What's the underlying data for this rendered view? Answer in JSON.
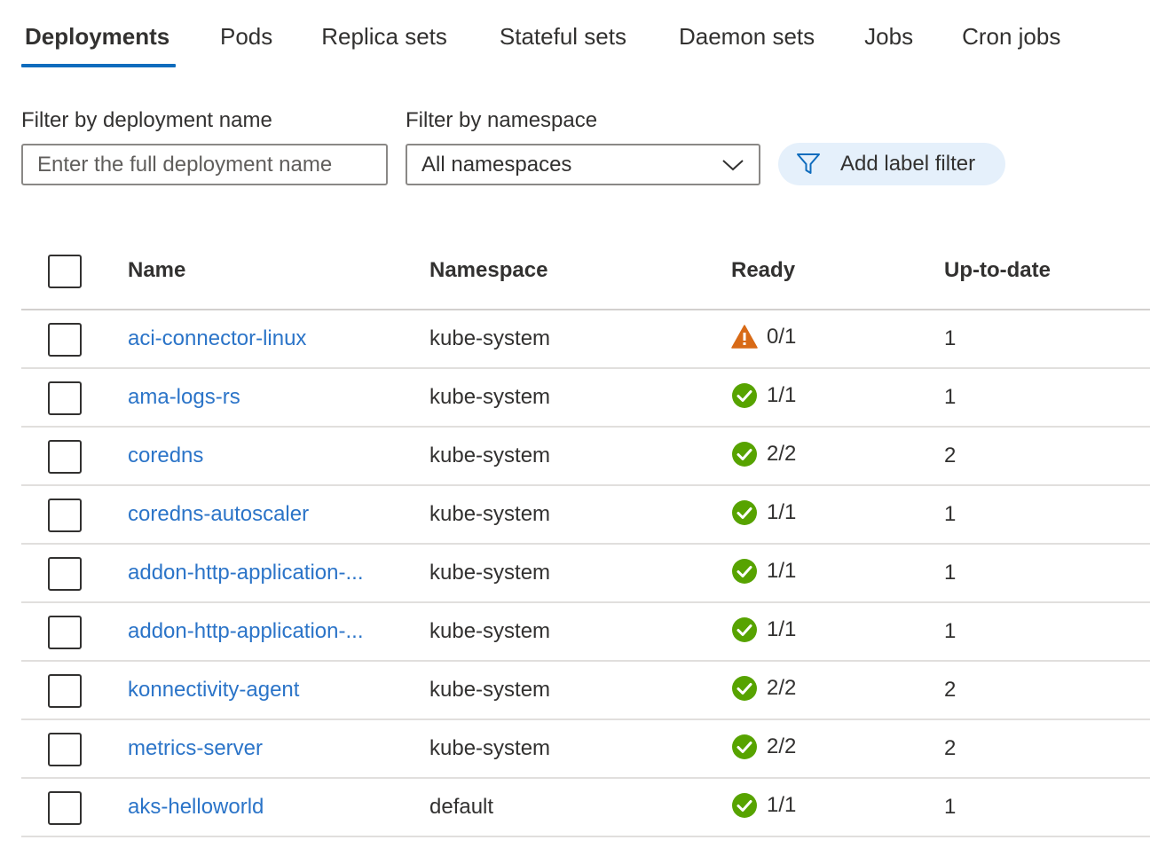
{
  "tabs": [
    {
      "label": "Deployments",
      "active": true
    },
    {
      "label": "Pods",
      "active": false
    },
    {
      "label": "Replica sets",
      "active": false
    },
    {
      "label": "Stateful sets",
      "active": false
    },
    {
      "label": "Daemon sets",
      "active": false
    },
    {
      "label": "Jobs",
      "active": false
    },
    {
      "label": "Cron jobs",
      "active": false
    }
  ],
  "filters": {
    "name_label": "Filter by deployment name",
    "name_placeholder": "Enter the full deployment name",
    "name_value": "",
    "namespace_label": "Filter by namespace",
    "namespace_value": "All namespaces",
    "add_label_filter": "Add label filter"
  },
  "table": {
    "headers": {
      "name": "Name",
      "namespace": "Namespace",
      "ready": "Ready",
      "uptodate": "Up-to-date"
    },
    "rows": [
      {
        "name": "aci-connector-linux",
        "namespace": "kube-system",
        "status": "warning",
        "ready": "0/1",
        "uptodate": "1"
      },
      {
        "name": "ama-logs-rs",
        "namespace": "kube-system",
        "status": "ok",
        "ready": "1/1",
        "uptodate": "1"
      },
      {
        "name": "coredns",
        "namespace": "kube-system",
        "status": "ok",
        "ready": "2/2",
        "uptodate": "2"
      },
      {
        "name": "coredns-autoscaler",
        "namespace": "kube-system",
        "status": "ok",
        "ready": "1/1",
        "uptodate": "1"
      },
      {
        "name": "addon-http-application-...",
        "namespace": "kube-system",
        "status": "ok",
        "ready": "1/1",
        "uptodate": "1"
      },
      {
        "name": "addon-http-application-...",
        "namespace": "kube-system",
        "status": "ok",
        "ready": "1/1",
        "uptodate": "1"
      },
      {
        "name": "konnectivity-agent",
        "namespace": "kube-system",
        "status": "ok",
        "ready": "2/2",
        "uptodate": "2"
      },
      {
        "name": "metrics-server",
        "namespace": "kube-system",
        "status": "ok",
        "ready": "2/2",
        "uptodate": "2"
      },
      {
        "name": "aks-helloworld",
        "namespace": "default",
        "status": "ok",
        "ready": "1/1",
        "uptodate": "1"
      }
    ]
  },
  "colors": {
    "accent": "#0f6cbd",
    "link": "#2b74c8",
    "ok": "#57a300",
    "warning": "#d86a16",
    "chip_bg": "#e5f0fb"
  },
  "icons": {
    "ok": "check-circle-icon",
    "warning": "warning-triangle-icon",
    "dropdown": "chevron-down-icon",
    "filter": "filter-funnel-icon"
  }
}
